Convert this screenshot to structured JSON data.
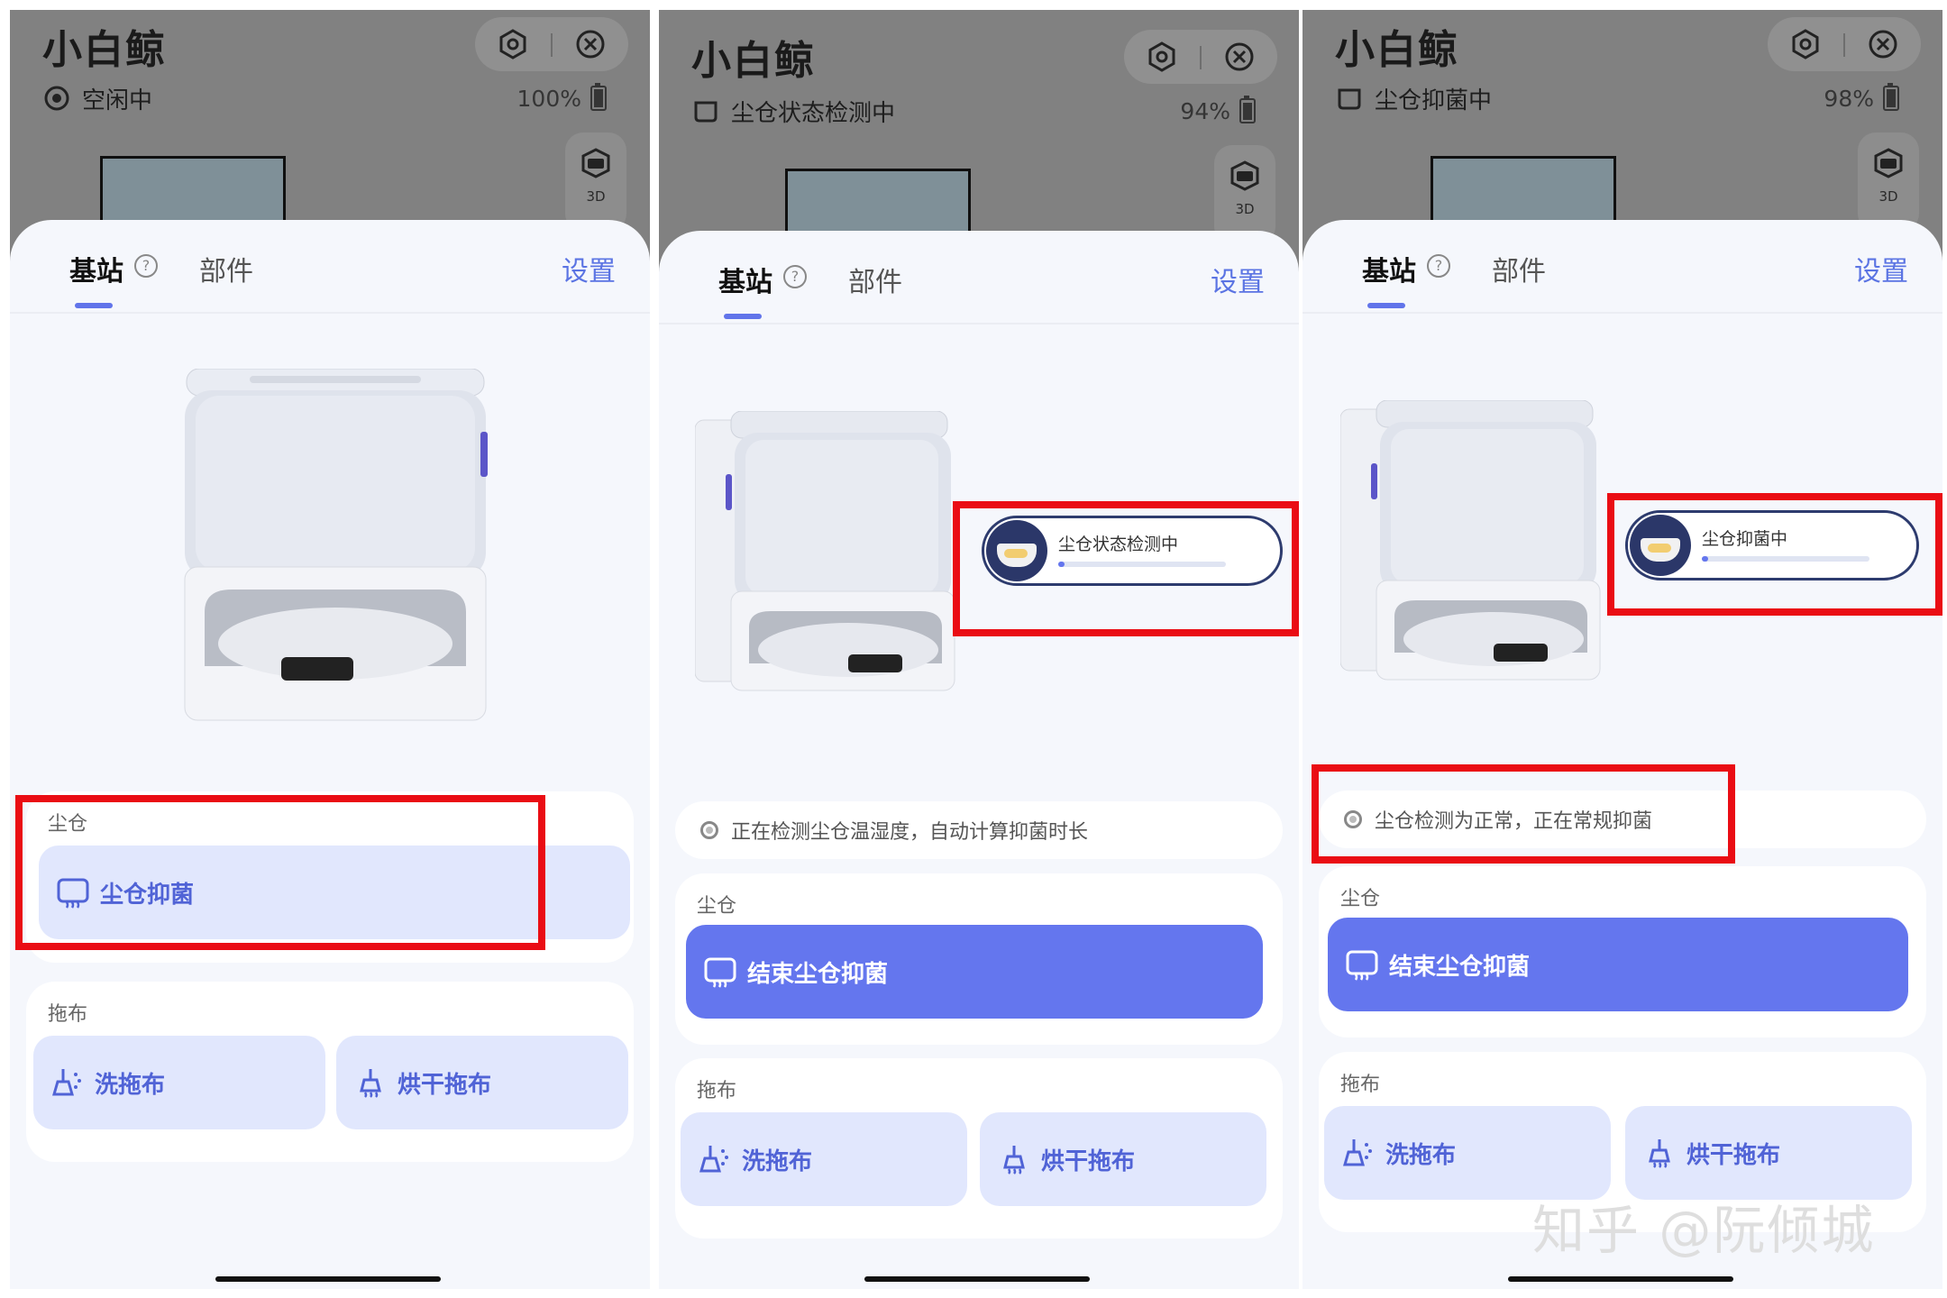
{
  "app_title": "小白鲸",
  "tabs": {
    "base": "基站",
    "help": "?",
    "parts": "部件",
    "settings": "设置"
  },
  "label_3d": "3D",
  "panels": [
    {
      "status": "空闲中",
      "battery": "100%",
      "battery_level": 1.0,
      "dust_label": "尘仓",
      "dust_button": "尘仓抑菌",
      "mop_label": "拖布",
      "wash_button": "洗拖布",
      "dry_button": "烘干拖布"
    },
    {
      "status": "尘仓状态检测中",
      "battery": "94%",
      "battery_level": 0.94,
      "pill_text": "尘仓状态检测中",
      "pill_progress": 0.02,
      "hint": "正在检测尘仓温湿度，自动计算抑菌时长",
      "dust_label": "尘仓",
      "dust_button": "结束尘仓抑菌",
      "mop_label": "拖布",
      "wash_button": "洗拖布",
      "dry_button": "烘干拖布"
    },
    {
      "status": "尘仓抑菌中",
      "battery": "98%",
      "battery_level": 0.98,
      "pill_text": "尘仓抑菌中",
      "pill_progress": 0.03,
      "hint": "尘仓检测为正常，正在常规抑菌",
      "dust_label": "尘仓",
      "dust_button": "结束尘仓抑菌",
      "mop_label": "拖布",
      "wash_button": "洗拖布",
      "dry_button": "烘干拖布"
    }
  ],
  "watermark": "知乎 @阮倾城",
  "colors": {
    "accent": "#6476EE",
    "highlight_box": "#EA0D14",
    "top_bg": "#818181"
  }
}
